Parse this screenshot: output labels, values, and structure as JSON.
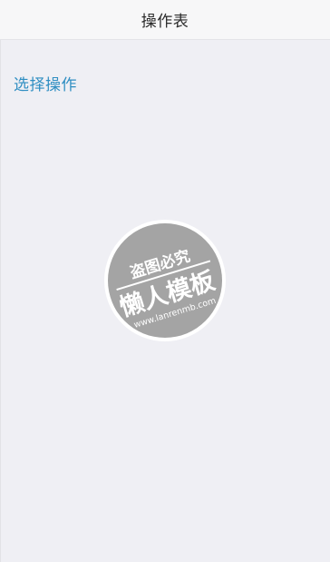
{
  "navbar": {
    "title": "操作表"
  },
  "main": {
    "action_label": "选择操作"
  },
  "watermark": {
    "top_text": "盗图必究",
    "main_text": "懒人模板",
    "url_text": "www.lanrenmb.com"
  }
}
